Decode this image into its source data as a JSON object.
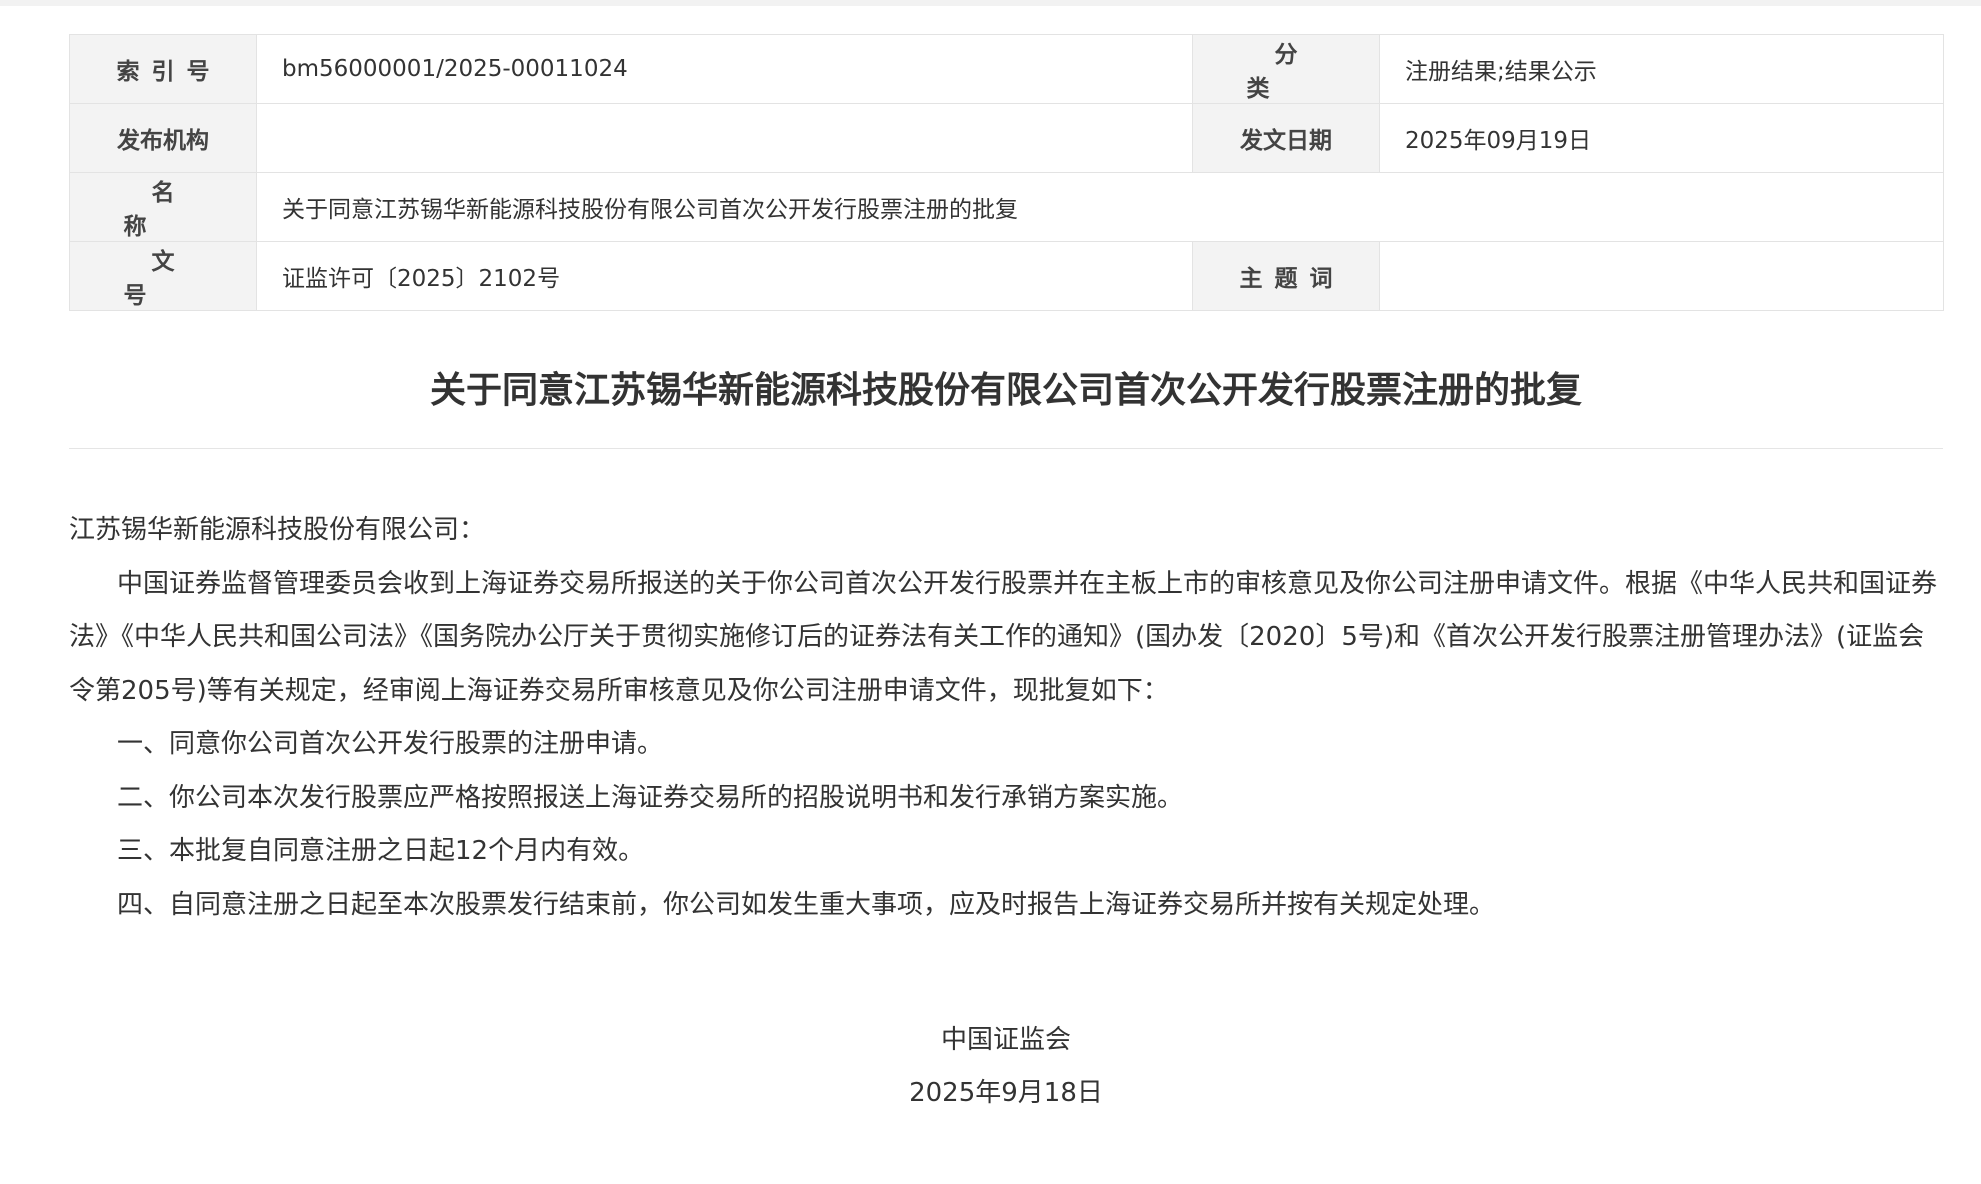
{
  "meta_table": {
    "index_label": "索引号",
    "index_value": "bm56000001/2025-00011024",
    "category_label": "分类",
    "category_value": "注册结果;结果公示",
    "issuer_label": "发布机构",
    "issuer_value": "",
    "date_label": "发文日期",
    "date_value": "2025年09月19日",
    "name_label": "名称",
    "name_value": "关于同意江苏锡华新能源科技股份有限公司首次公开发行股票注册的批复",
    "docno_label": "文号",
    "docno_value": "证监许可〔2025〕2102号",
    "keywords_label": "主题词",
    "keywords_value": ""
  },
  "document": {
    "title": "关于同意江苏锡华新能源科技股份有限公司首次公开发行股票注册的批复",
    "salutation": "江苏锡华新能源科技股份有限公司：",
    "paragraph_main": "中国证券监督管理委员会收到上海证券交易所报送的关于你公司首次公开发行股票并在主板上市的审核意见及你公司注册申请文件。根据《中华人民共和国证券法》《中华人民共和国公司法》《国务院办公厅关于贯彻实施修订后的证券法有关工作的通知》(国办发〔2020〕5号)和《首次公开发行股票注册管理办法》(证监会令第205号)等有关规定，经审阅上海证券交易所审核意见及你公司注册申请文件，现批复如下：",
    "items": [
      "一、同意你公司首次公开发行股票的注册申请。",
      "二、你公司本次发行股票应严格按照报送上海证券交易所的招股说明书和发行承销方案实施。",
      "三、本批复自同意注册之日起12个月内有效。",
      "四、自同意注册之日起至本次股票发行结束前，你公司如发生重大事项，应及时报告上海证券交易所并按有关规定处理。"
    ],
    "signature": "中国证监会",
    "sign_date": "2025年9月18日"
  }
}
